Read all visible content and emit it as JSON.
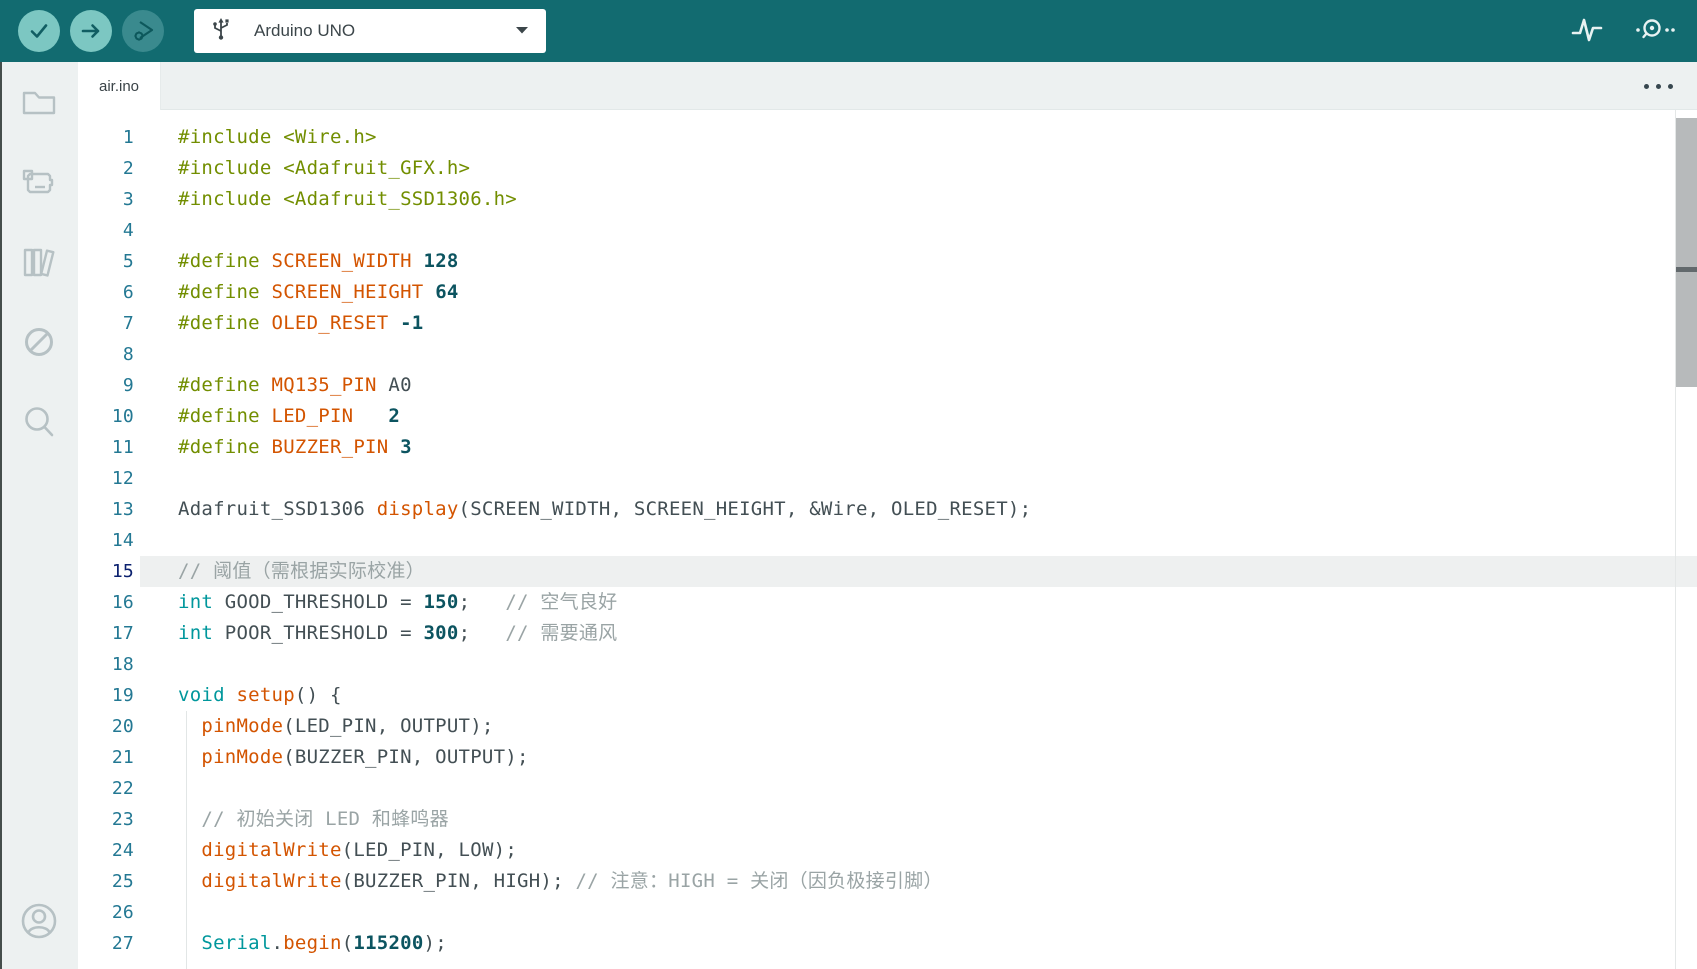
{
  "toolbar": {
    "buttons": [
      {
        "name": "verify",
        "icon": "checkmark-icon",
        "enabled": true
      },
      {
        "name": "upload",
        "icon": "arrow-right-icon",
        "enabled": true
      },
      {
        "name": "debug",
        "icon": "debug-play-gear-icon",
        "enabled": false
      }
    ],
    "board_selector": {
      "label": "Arduino UNO",
      "left_icon": "usb-icon",
      "right_icon": "chevron-down-icon"
    },
    "right_buttons": [
      {
        "name": "serial-plotter",
        "icon": "waveform-icon"
      },
      {
        "name": "serial-monitor",
        "icon": "magnifier-dots-icon"
      }
    ]
  },
  "sidebar": {
    "items": [
      {
        "name": "sketchbook",
        "icon": "folder-icon"
      },
      {
        "name": "boards-manager",
        "icon": "circuit-board-icon"
      },
      {
        "name": "library-manager",
        "icon": "books-icon"
      },
      {
        "name": "debugger",
        "icon": "slashed-circle-icon"
      },
      {
        "name": "search",
        "icon": "search-icon"
      },
      {
        "name": "account",
        "icon": "person-icon"
      }
    ]
  },
  "tabs": {
    "items": [
      {
        "label": "air.ino",
        "active": true
      }
    ],
    "more_menu_icon": "ellipsis-icon"
  },
  "editor": {
    "active_line": 15,
    "lines": [
      {
        "n": 1,
        "tokens": [
          [
            "p",
            "#include <Wire.h>"
          ]
        ]
      },
      {
        "n": 2,
        "tokens": [
          [
            "p",
            "#include <Adafruit_GFX.h>"
          ]
        ]
      },
      {
        "n": 3,
        "tokens": [
          [
            "p",
            "#include <Adafruit_SSD1306.h>"
          ]
        ]
      },
      {
        "n": 4,
        "tokens": []
      },
      {
        "n": 5,
        "tokens": [
          [
            "p",
            "#define "
          ],
          [
            "o",
            "SCREEN_WIDTH"
          ],
          [
            "t",
            " "
          ],
          [
            "n",
            "128"
          ]
        ]
      },
      {
        "n": 6,
        "tokens": [
          [
            "p",
            "#define "
          ],
          [
            "o",
            "SCREEN_HEIGHT"
          ],
          [
            "t",
            " "
          ],
          [
            "n",
            "64"
          ]
        ]
      },
      {
        "n": 7,
        "tokens": [
          [
            "p",
            "#define "
          ],
          [
            "o",
            "OLED_RESET"
          ],
          [
            "t",
            " "
          ],
          [
            "n",
            "-1"
          ]
        ]
      },
      {
        "n": 8,
        "tokens": []
      },
      {
        "n": 9,
        "tokens": [
          [
            "p",
            "#define "
          ],
          [
            "o",
            "MQ135_PIN"
          ],
          [
            "t",
            " A0"
          ]
        ]
      },
      {
        "n": 10,
        "tokens": [
          [
            "p",
            "#define "
          ],
          [
            "o",
            "LED_PIN"
          ],
          [
            "t",
            "   "
          ],
          [
            "n",
            "2"
          ]
        ]
      },
      {
        "n": 11,
        "tokens": [
          [
            "p",
            "#define "
          ],
          [
            "o",
            "BUZZER_PIN"
          ],
          [
            "t",
            " "
          ],
          [
            "n",
            "3"
          ]
        ]
      },
      {
        "n": 12,
        "tokens": []
      },
      {
        "n": 13,
        "tokens": [
          [
            "t",
            "Adafruit_SSD1306 "
          ],
          [
            "o",
            "display"
          ],
          [
            "t",
            "(SCREEN_WIDTH, SCREEN_HEIGHT, &Wire, OLED_RESET);"
          ]
        ]
      },
      {
        "n": 14,
        "tokens": []
      },
      {
        "n": 15,
        "tokens": [
          [
            "c",
            "// 阈值（需根据实际校准）"
          ]
        ]
      },
      {
        "n": 16,
        "tokens": [
          [
            "k",
            "int"
          ],
          [
            "t",
            " GOOD_THRESHOLD = "
          ],
          [
            "n",
            "150"
          ],
          [
            "t",
            ";   "
          ],
          [
            "c",
            "// 空气良好"
          ]
        ]
      },
      {
        "n": 17,
        "tokens": [
          [
            "k",
            "int"
          ],
          [
            "t",
            " POOR_THRESHOLD = "
          ],
          [
            "n",
            "300"
          ],
          [
            "t",
            ";   "
          ],
          [
            "c",
            "// 需要通风"
          ]
        ]
      },
      {
        "n": 18,
        "tokens": []
      },
      {
        "n": 19,
        "tokens": [
          [
            "k",
            "void"
          ],
          [
            "t",
            " "
          ],
          [
            "o",
            "setup"
          ],
          [
            "t",
            "() {"
          ]
        ]
      },
      {
        "n": 20,
        "tokens": [
          [
            "t",
            "  "
          ],
          [
            "o",
            "pinMode"
          ],
          [
            "t",
            "(LED_PIN, OUTPUT);"
          ]
        ]
      },
      {
        "n": 21,
        "tokens": [
          [
            "t",
            "  "
          ],
          [
            "o",
            "pinMode"
          ],
          [
            "t",
            "(BUZZER_PIN, OUTPUT);"
          ]
        ]
      },
      {
        "n": 22,
        "tokens": []
      },
      {
        "n": 23,
        "tokens": [
          [
            "t",
            "  "
          ],
          [
            "c",
            "// 初始关闭 LED 和蜂鸣器"
          ]
        ]
      },
      {
        "n": 24,
        "tokens": [
          [
            "t",
            "  "
          ],
          [
            "o",
            "digitalWrite"
          ],
          [
            "t",
            "(LED_PIN, LOW);"
          ]
        ]
      },
      {
        "n": 25,
        "tokens": [
          [
            "t",
            "  "
          ],
          [
            "o",
            "digitalWrite"
          ],
          [
            "t",
            "(BUZZER_PIN, HIGH); "
          ],
          [
            "c",
            "// 注意：HIGH = 关闭（因负极接引脚）"
          ]
        ]
      },
      {
        "n": 26,
        "tokens": []
      },
      {
        "n": 27,
        "tokens": [
          [
            "t",
            "  "
          ],
          [
            "k",
            "Serial"
          ],
          [
            "t",
            "."
          ],
          [
            "o",
            "begin"
          ],
          [
            "t",
            "("
          ],
          [
            "n",
            "115200"
          ],
          [
            "t",
            ");"
          ]
        ]
      }
    ]
  },
  "colors": {
    "toolbar_bg": "#126b70",
    "toolbar_btn_bg": "#7cc7c2",
    "toolbar_btn_glyph": "#115e63",
    "toolbar_btn_disabled_bg": "#3a8a8e",
    "toolbar_btn_disabled_glyph": "#0d585c",
    "panel_bg": "#edf1f1",
    "sidebar_icon": "#b6c1c4",
    "tab_text": "#3a4347",
    "gutter_num": "#237893",
    "gutter_num_active": "#0b216f",
    "line_highlight": "#eef0f0",
    "code_text": "#434f54",
    "code_preproc": "#728e00",
    "code_orange": "#d35400",
    "code_keyword": "#00979c",
    "code_number": "#0c5460",
    "code_comment": "#9aa4a5",
    "scrollbar_thumb": "#b7babb",
    "scrollbar_marker": "#62696c"
  }
}
